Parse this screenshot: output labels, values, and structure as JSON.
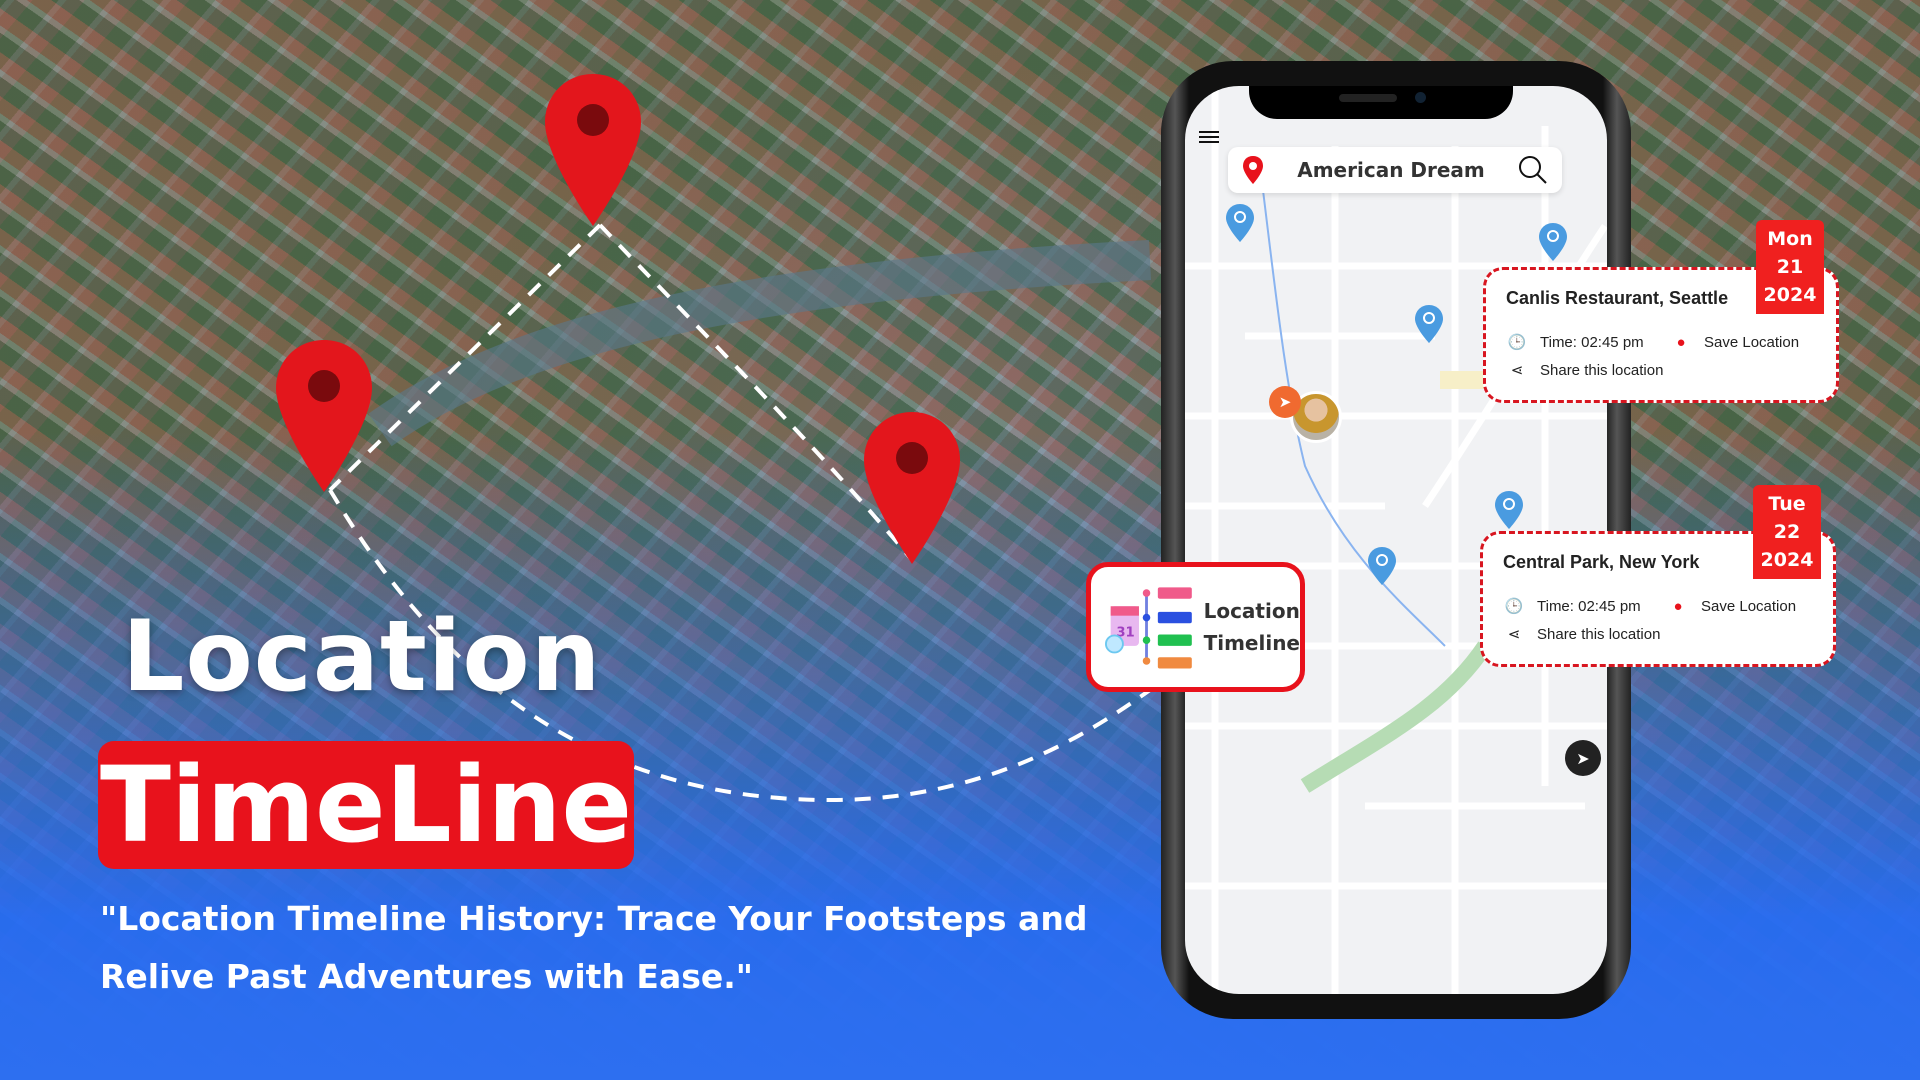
{
  "hero": {
    "title_line1": "Location",
    "title_line2": "TimeLine",
    "tagline": "\"Location Timeline History: Trace Your Footsteps and Relive Past Adventures with Ease.\""
  },
  "badge_box": {
    "line1": "Location",
    "line2": "Timeline"
  },
  "phone": {
    "search": {
      "value": "American Dream",
      "left_icon": "map-pin-icon",
      "right_icon": "search-icon"
    },
    "cards": [
      {
        "place": "Canlis Restaurant, Seattle",
        "time": "Time: 02:45 pm",
        "save": "Save Location",
        "share": "Share this location",
        "date": {
          "day": "Mon",
          "num": "21",
          "year": "2024"
        }
      },
      {
        "place": "Central Park, New York",
        "time": "Time: 02:45 pm",
        "save": "Save Location",
        "share": "Share this location",
        "date": {
          "day": "Tue",
          "num": "22",
          "year": "2024"
        }
      }
    ]
  },
  "colors": {
    "accent_red": "#e8121c",
    "blue_overlay": "#2d6ff0",
    "map_pin_blue": "#4a9be0"
  }
}
